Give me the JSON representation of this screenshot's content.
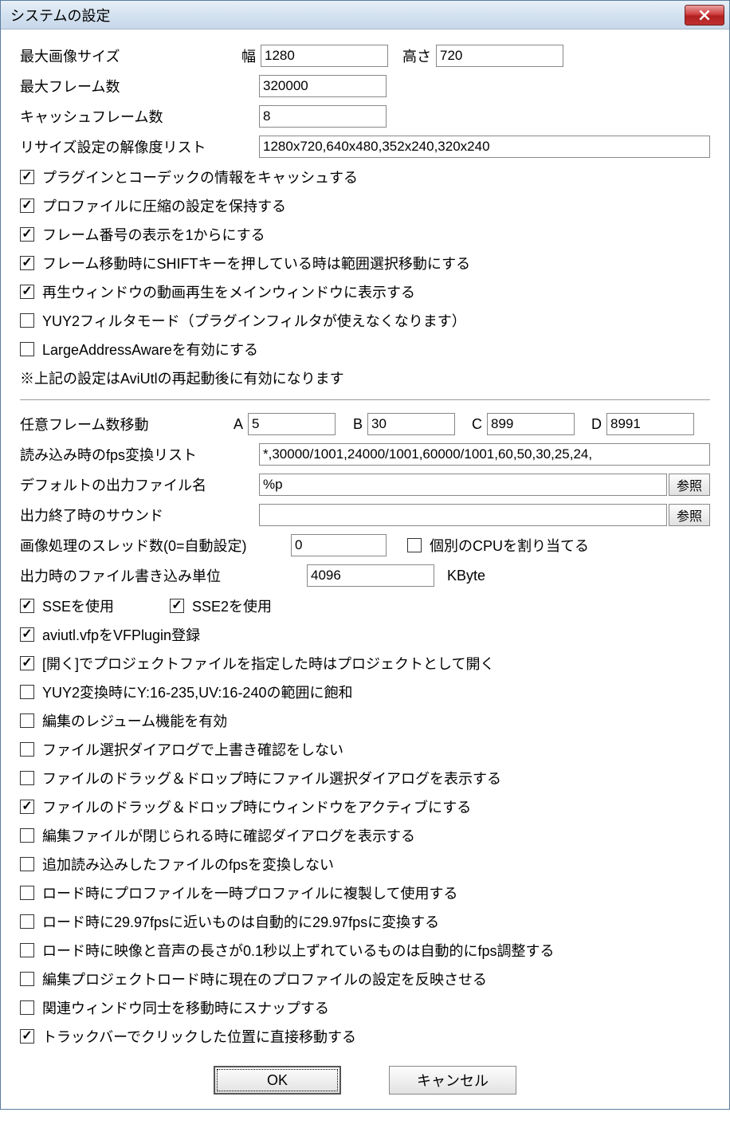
{
  "window": {
    "title": "システムの設定"
  },
  "section1": {
    "max_image_size_label": "最大画像サイズ",
    "width_label": "幅",
    "width_value": "1280",
    "height_label": "高さ",
    "height_value": "720",
    "max_frames_label": "最大フレーム数",
    "max_frames_value": "320000",
    "cache_frames_label": "キャッシュフレーム数",
    "cache_frames_value": "8",
    "resize_list_label": "リサイズ設定の解像度リスト",
    "resize_list_value": "1280x720,640x480,352x240,320x240",
    "checkboxes": [
      {
        "label": "プラグインとコーデックの情報をキャッシュする",
        "checked": true
      },
      {
        "label": "プロファイルに圧縮の設定を保持する",
        "checked": true
      },
      {
        "label": "フレーム番号の表示を1からにする",
        "checked": true
      },
      {
        "label": "フレーム移動時にSHIFTキーを押している時は範囲選択移動にする",
        "checked": true
      },
      {
        "label": "再生ウィンドウの動画再生をメインウィンドウに表示する",
        "checked": true
      },
      {
        "label": "YUY2フィルタモード（プラグインフィルタが使えなくなります）",
        "checked": false
      },
      {
        "label": "LargeAddressAwareを有効にする",
        "checked": false
      }
    ],
    "note": "※上記の設定はAviUtlの再起動後に有効になります"
  },
  "section2": {
    "jump_frames_label": "任意フレーム数移動",
    "jump_A_label": "A",
    "jump_A_value": "5",
    "jump_B_label": "B",
    "jump_B_value": "30",
    "jump_C_label": "C",
    "jump_C_value": "899",
    "jump_D_label": "D",
    "jump_D_value": "8991",
    "fps_list_label": "読み込み時のfps変換リスト",
    "fps_list_value": "*,30000/1001,24000/1001,60000/1001,60,50,30,25,24,",
    "default_output_label": "デフォルトの出力ファイル名",
    "default_output_value": "%p",
    "browse_label": "参照",
    "end_sound_label": "出力終了時のサウンド",
    "end_sound_value": "",
    "threads_label": "画像処理のスレッド数(0=自動設定)",
    "threads_value": "0",
    "cpu_assign_label": "個別のCPUを割り当てる",
    "cpu_assign_checked": false,
    "write_unit_label": "出力時のファイル書き込み単位",
    "write_unit_value": "4096",
    "write_unit_suffix": "KByte",
    "sse_label": "SSEを使用",
    "sse_checked": true,
    "sse2_label": "SSE2を使用",
    "sse2_checked": true,
    "checkboxes": [
      {
        "label": "aviutl.vfpをVFPlugin登録",
        "checked": true
      },
      {
        "label": "[開く]でプロジェクトファイルを指定した時はプロジェクトとして開く",
        "checked": true
      },
      {
        "label": "YUY2変換時にY:16-235,UV:16-240の範囲に飽和",
        "checked": false
      },
      {
        "label": "編集のレジューム機能を有効",
        "checked": false
      },
      {
        "label": "ファイル選択ダイアログで上書き確認をしない",
        "checked": false
      },
      {
        "label": "ファイルのドラッグ＆ドロップ時にファイル選択ダイアログを表示する",
        "checked": false
      },
      {
        "label": "ファイルのドラッグ＆ドロップ時にウィンドウをアクティブにする",
        "checked": true
      },
      {
        "label": "編集ファイルが閉じられる時に確認ダイアログを表示する",
        "checked": false
      },
      {
        "label": "追加読み込みしたファイルのfpsを変換しない",
        "checked": false
      },
      {
        "label": "ロード時にプロファイルを一時プロファイルに複製して使用する",
        "checked": false
      },
      {
        "label": "ロード時に29.97fpsに近いものは自動的に29.97fpsに変換する",
        "checked": false
      },
      {
        "label": "ロード時に映像と音声の長さが0.1秒以上ずれているものは自動的にfps調整する",
        "checked": false
      },
      {
        "label": "編集プロジェクトロード時に現在のプロファイルの設定を反映させる",
        "checked": false
      },
      {
        "label": "関連ウィンドウ同士を移動時にスナップする",
        "checked": false
      },
      {
        "label": "トラックバーでクリックした位置に直接移動する",
        "checked": true
      }
    ]
  },
  "buttons": {
    "ok": "OK",
    "cancel": "キャンセル"
  }
}
